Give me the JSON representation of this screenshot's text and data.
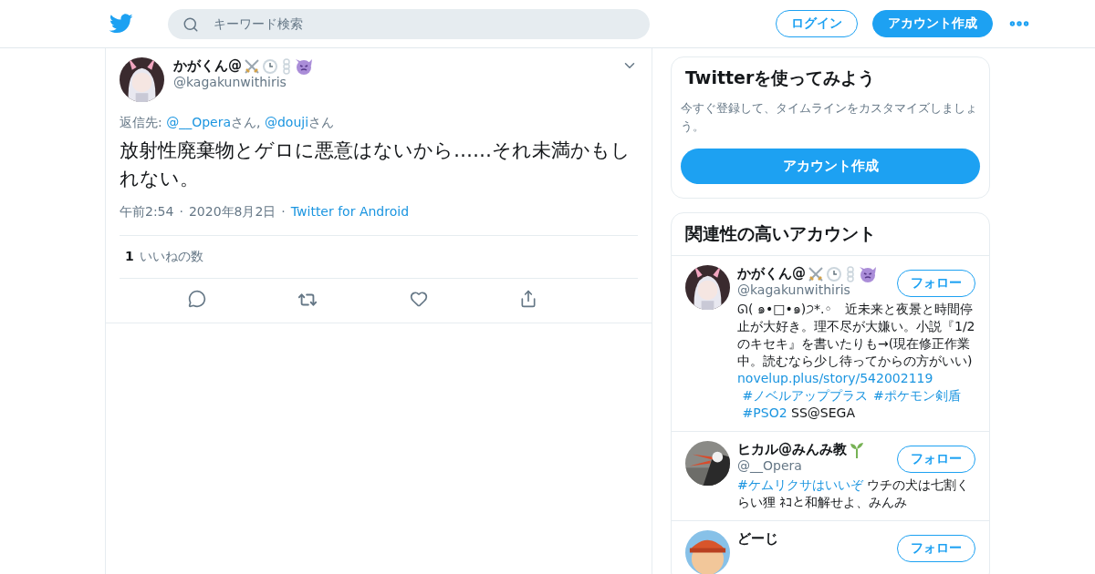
{
  "header": {
    "search": {
      "placeholder": "キーワード検索"
    },
    "login": "ログイン",
    "signup": "アカウント作成"
  },
  "tweet": {
    "name": "かがくん@",
    "handle": "@kagakunwithiris",
    "reply_to": [
      {
        "kind": "text",
        "text": "返信先: "
      },
      {
        "kind": "link",
        "text": "@__Opera"
      },
      {
        "kind": "text",
        "text": "さん, "
      },
      {
        "kind": "link",
        "text": "@douji"
      },
      {
        "kind": "text",
        "text": "さん"
      }
    ],
    "body": "放射性廃棄物とゲロに悪意はないから……それ未満かもしれない。",
    "meta": [
      {
        "kind": "text",
        "text": "午前2:54"
      },
      {
        "kind": "sep",
        "text": "·"
      },
      {
        "kind": "text",
        "text": "2020年8月2日"
      },
      {
        "kind": "sep",
        "text": "·"
      },
      {
        "kind": "link",
        "text": "Twitter for Android"
      }
    ],
    "likes_count": "1",
    "likes_label": "いいねの数"
  },
  "signup_card": {
    "title": "Twitterを使ってみよう",
    "text": "今すぐ登録して、タイムラインをカスタマイズしましょう。",
    "button": "アカウント作成"
  },
  "related": {
    "title": "関連性の高いアカウント",
    "accounts": [
      {
        "name": "かがくん@",
        "handle": "@kagakunwithiris",
        "follow": "フォロー",
        "bio": [
          {
            "kind": "text",
            "text": "ᘏ( ๑•□•๑)੭*.◦　近未来と夜景と時間停止が大好き。理不尽が大嫌い。小説『1/2のキセキ』を書いたりも→(現在修正作業中。読むなら少し待ってからの方がいい) "
          },
          {
            "kind": "link",
            "text": "novelup.plus/story/542002119"
          },
          {
            "kind": "link",
            "text": "#ノベルアッププラス"
          },
          {
            "kind": "link",
            "text": "#ポケモン剣盾"
          },
          {
            "kind": "link",
            "text": "#PSO2"
          },
          {
            "kind": "text",
            "text": " SS@SEGA"
          }
        ]
      },
      {
        "name": "ヒカル@みんみ教",
        "handle": "@__Opera",
        "follow": "フォロー",
        "bio": [
          {
            "kind": "link",
            "text": "#ケムリクサはいいぞ"
          },
          {
            "kind": "text",
            "text": " ウチの犬は七割くらい狸 ﾈｺと和解せよ、みんみ"
          }
        ]
      },
      {
        "name": "どーじ",
        "follow": "フォロー"
      }
    ]
  }
}
